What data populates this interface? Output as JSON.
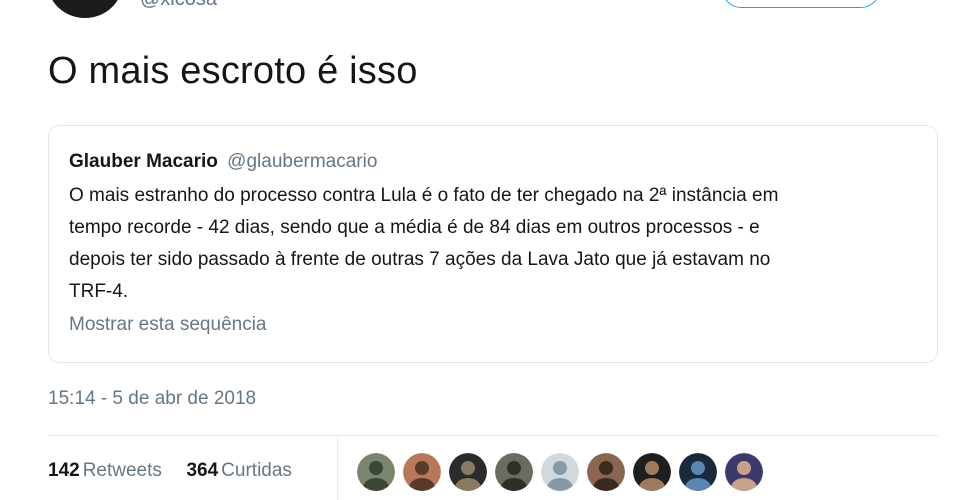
{
  "header": {
    "handle": "@xicosa"
  },
  "tweet": {
    "text": "O mais escroto é isso",
    "timestamp": "15:14 - 5 de abr de 2018"
  },
  "quote": {
    "name": "Glauber Macario",
    "handle": "@glaubermacario",
    "lines": [
      "O mais estranho do processo contra Lula é o fato de ter chegado na 2ª instância em",
      "tempo recorde - 42 dias, sendo que a média é de 84 dias em outros processos - e",
      "depois ter sido passado à frente de outras 7 ações da Lava Jato que já estavam no",
      "TRF-4."
    ],
    "show_thread": "Mostrar esta sequência"
  },
  "stats": {
    "retweets_count": "142",
    "retweets_label": "Retweets",
    "likes_count": "364",
    "likes_label": "Curtidas"
  },
  "likers": [
    {
      "name": "liker-avatar-1",
      "bg": "#7a8570",
      "fg": "#3c4636"
    },
    {
      "name": "liker-avatar-2",
      "bg": "#b9785a",
      "fg": "#5a3a2c"
    },
    {
      "name": "liker-avatar-3",
      "bg": "#2b2b2b",
      "fg": "#8a7a60"
    },
    {
      "name": "liker-avatar-4",
      "bg": "#6b6b60",
      "fg": "#2f2f2a"
    },
    {
      "name": "liker-avatar-5",
      "bg": "#cfd9de",
      "fg": "#8899a6"
    },
    {
      "name": "liker-avatar-6",
      "bg": "#8a6650",
      "fg": "#3b2a20"
    },
    {
      "name": "liker-avatar-7",
      "bg": "#1f1f1f",
      "fg": "#a07a5c"
    },
    {
      "name": "liker-avatar-8",
      "bg": "#1a2a3a",
      "fg": "#5b86b0"
    },
    {
      "name": "liker-avatar-9",
      "bg": "#3b3a6a",
      "fg": "#c9a08a"
    }
  ]
}
